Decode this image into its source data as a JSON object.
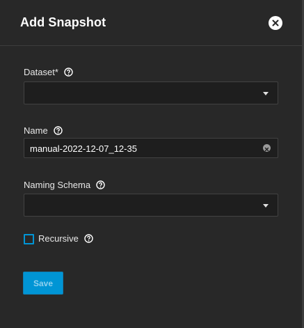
{
  "dialog": {
    "title": "Add Snapshot",
    "close_icon": "close-icon"
  },
  "form": {
    "dataset": {
      "label": "Dataset",
      "required_mark": "*",
      "value": "",
      "icon": "help-circle-icon"
    },
    "name": {
      "label": "Name",
      "value": "manual-2022-12-07_12-35",
      "icon": "help-circle-icon"
    },
    "naming_schema": {
      "label": "Naming Schema",
      "value": "",
      "icon": "help-circle-icon"
    },
    "recursive": {
      "label": "Recursive",
      "checked": false,
      "icon": "help-circle-icon"
    },
    "save_label": "Save"
  },
  "colors": {
    "accent": "#0095d5",
    "panel_bg": "#282828",
    "field_bg": "#1e1e1e"
  }
}
